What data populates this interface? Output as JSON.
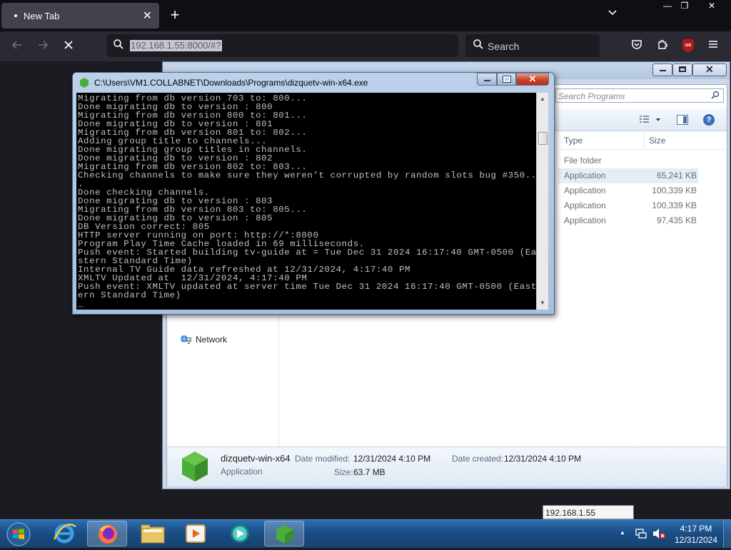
{
  "browser": {
    "tab_title": "New Tab",
    "tab_close": "✕",
    "new_tab": "+",
    "url": "192.168.1.55:8000/#?",
    "search_placeholder": "Search",
    "window_controls": [
      "—",
      "❐",
      "✕"
    ]
  },
  "explorer": {
    "search_placeholder": "Search Programs",
    "columns": {
      "type": "Type",
      "size": "Size"
    },
    "rows": [
      {
        "type": "File folder",
        "size": ""
      },
      {
        "type": "Application",
        "size": "65,241 KB"
      },
      {
        "type": "Application",
        "size": "100,339 KB"
      },
      {
        "type": "Application",
        "size": "100,339 KB"
      },
      {
        "type": "Application",
        "size": "97,435 KB"
      }
    ],
    "nav_network": "Network",
    "details": {
      "name": "dizquetv-win-x64",
      "kind": "Application",
      "date_modified_label": "Date modified:",
      "date_modified": "12/31/2024 4:10 PM",
      "size_label": "Size:",
      "size": "63.7 MB",
      "date_created_label": "Date created:",
      "date_created": "12/31/2024 4:10 PM"
    }
  },
  "console": {
    "title": "C:\\Users\\VM1.COLLABNET\\Downloads\\Programs\\dizquetv-win-x64.exe",
    "lines": [
      "Migrating from db version 703 to: 800...",
      "Done migrating db to version : 800",
      "Migrating from db version 800 to: 801...",
      "Done migrating db to version : 801",
      "Migrating from db version 801 to: 802...",
      "Adding group title to channels...",
      "Done migrating group titles in channels.",
      "Done migrating db to version : 802",
      "Migrating from db version 802 to: 803...",
      "Checking channels to make sure they weren't corrupted by random slots bug #350..",
      ".",
      "Done checking channels.",
      "Done migrating db to version : 803",
      "Migrating from db version 803 to: 805...",
      "Done migrating db to version : 805",
      "DB Version correct: 805",
      "HTTP server running on port: http://*:8000",
      "Program Play Time Cache loaded in 69 milliseconds.",
      "Push event: Started building tv-guide at = Tue Dec 31 2024 16:17:40 GMT-0500 (Ea",
      "stern Standard Time)",
      "Internal TV Guide data refreshed at 12/31/2024, 4:17:40 PM",
      "XMLTV Updated at  12/31/2024, 4:17:40 PM",
      "Push event: XMLTV updated at server time Tue Dec 31 2024 16:17:40 GMT-0500 (East",
      "ern Standard Time)",
      "_"
    ]
  },
  "taskbar": {
    "tooltip": "192.168.1.55",
    "time": "4:17 PM",
    "date": "12/31/2024"
  }
}
